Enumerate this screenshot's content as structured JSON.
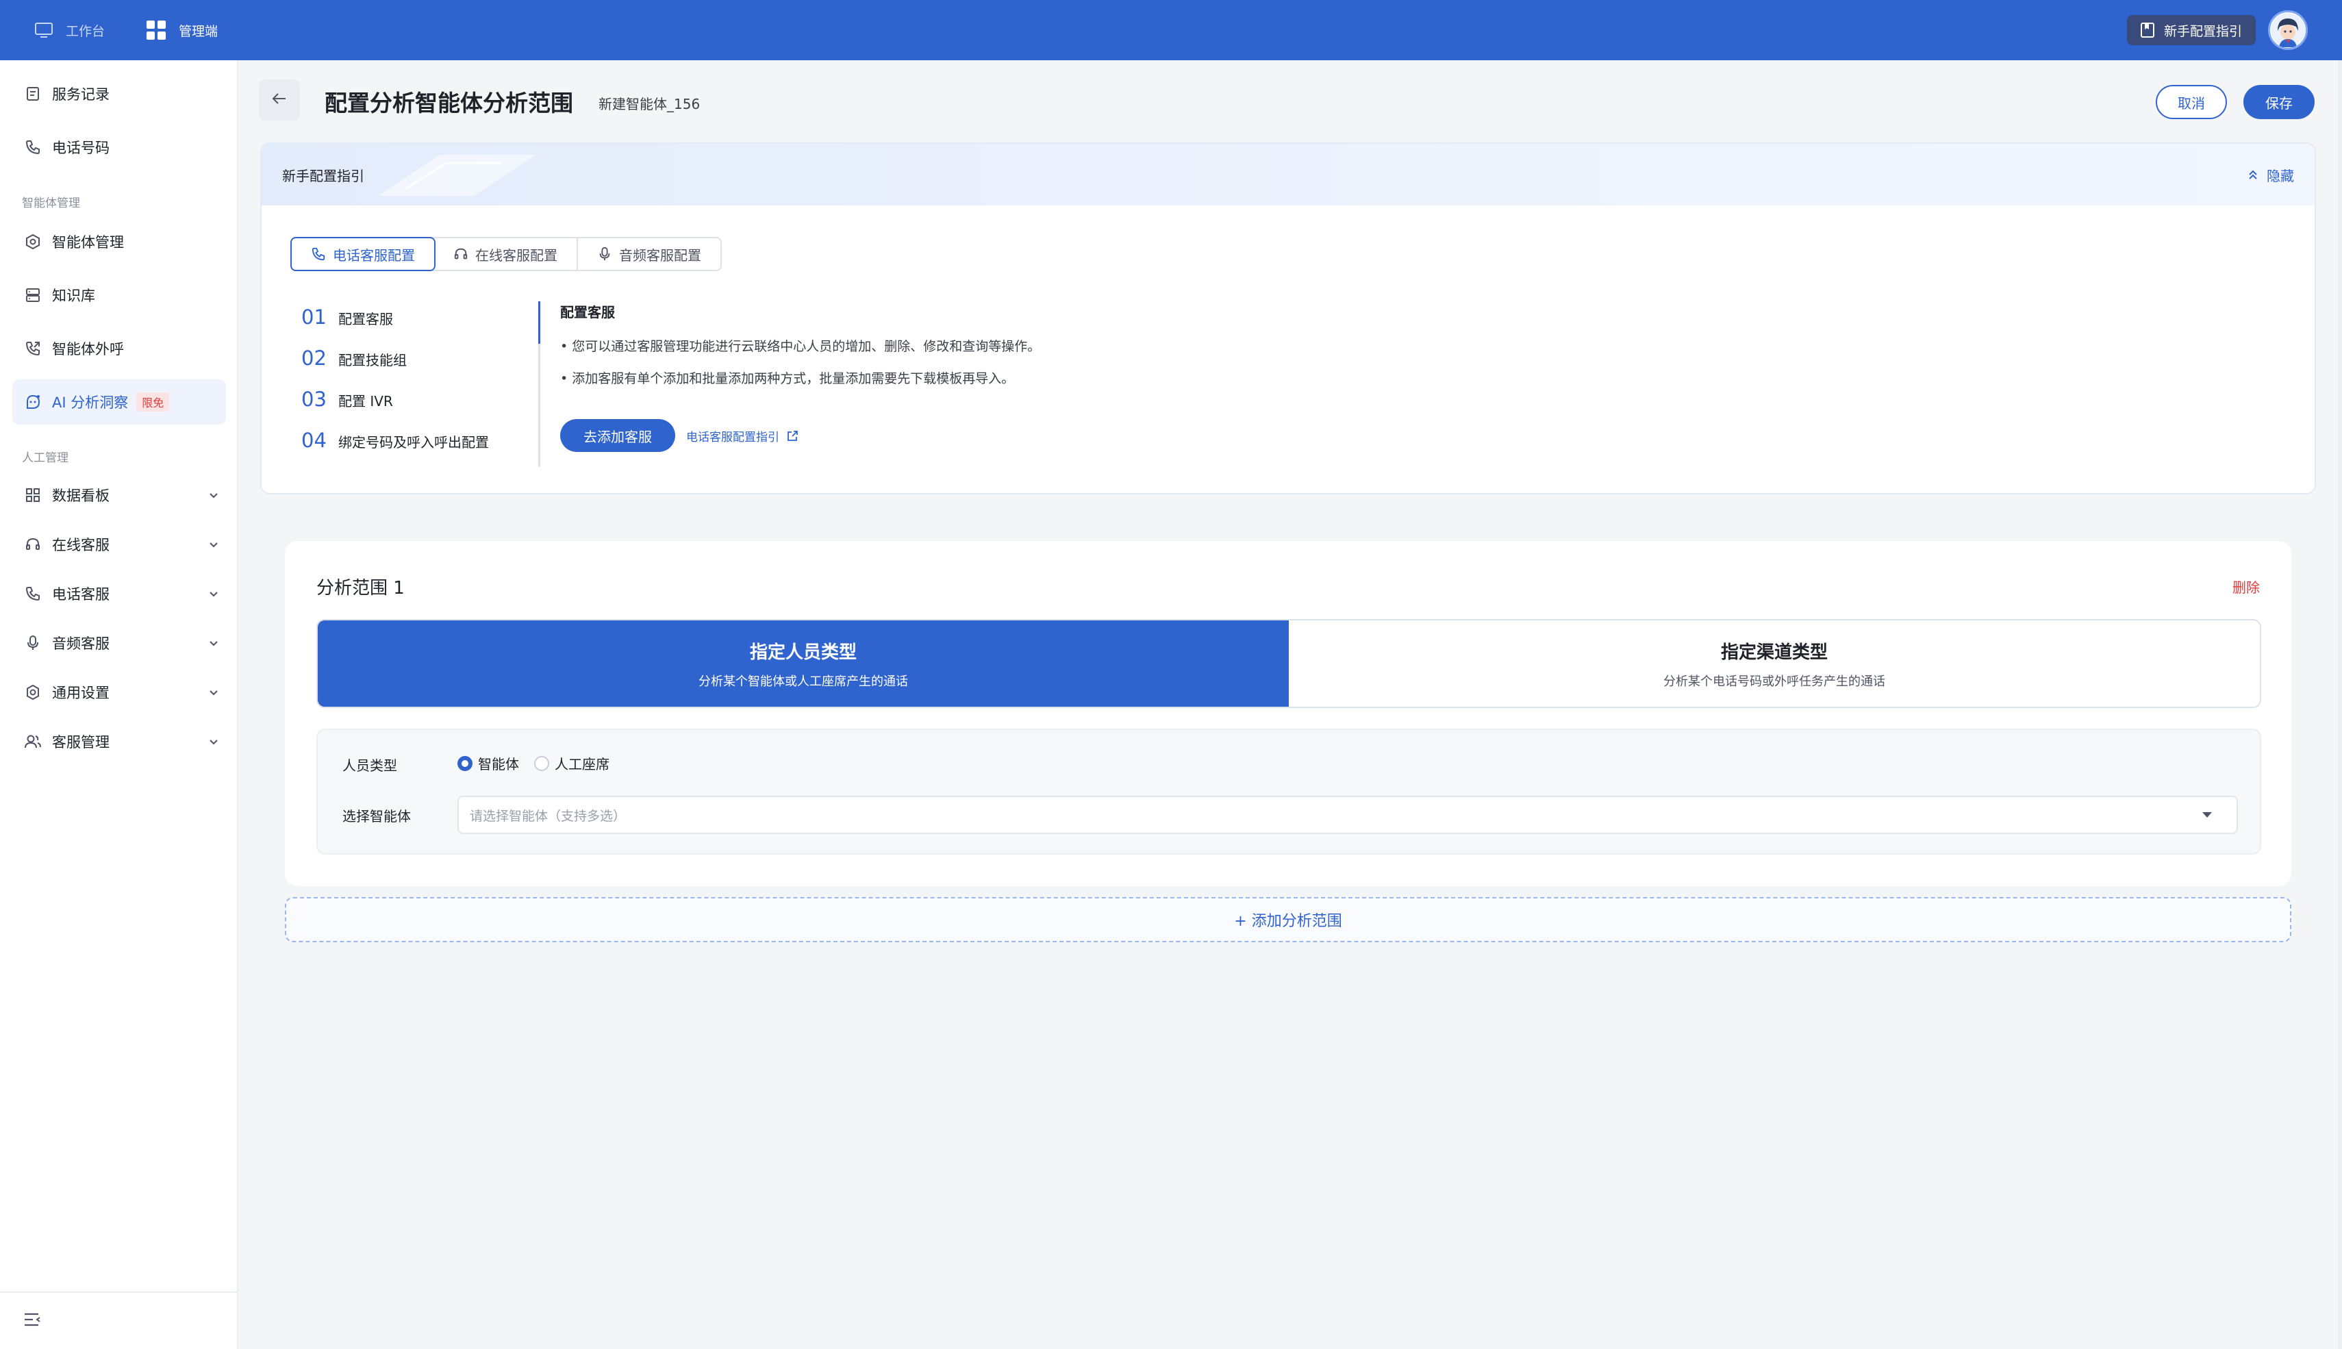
{
  "topbar": {
    "tabs": [
      {
        "label": "工作台",
        "icon": "monitor-icon"
      },
      {
        "label": "管理端",
        "icon": "grid-icon"
      }
    ],
    "guide_button": "新手配置指引"
  },
  "sidebar": {
    "items_top": [
      {
        "label": "服务记录",
        "icon": "document-icon"
      },
      {
        "label": "电话号码",
        "icon": "phone-icon"
      }
    ],
    "section_agent": "智能体管理",
    "items_agent": [
      {
        "label": "智能体管理",
        "icon": "hexagon-gear-icon"
      },
      {
        "label": "知识库",
        "icon": "database-icon"
      },
      {
        "label": "智能体外呼",
        "icon": "phone-outgoing-icon"
      },
      {
        "label": "AI 分析洞察",
        "icon": "ai-robot-icon",
        "badge": "限免"
      }
    ],
    "section_human": "人工管理",
    "items_human": [
      {
        "label": "数据看板",
        "icon": "dashboard-icon"
      },
      {
        "label": "在线客服",
        "icon": "headset-icon"
      },
      {
        "label": "电话客服",
        "icon": "phone-icon"
      },
      {
        "label": "音频客服",
        "icon": "microphone-icon"
      },
      {
        "label": "通用设置",
        "icon": "gear-icon"
      },
      {
        "label": "客服管理",
        "icon": "users-icon"
      }
    ]
  },
  "header": {
    "title": "配置分析智能体分析范围",
    "subtitle": "新建智能体_156",
    "cancel": "取消",
    "save": "保存"
  },
  "guide": {
    "title": "新手配置指引",
    "hide": "隐藏",
    "tabs": [
      "电话客服配置",
      "在线客服配置",
      "音频客服配置"
    ],
    "steps": [
      {
        "num": "01",
        "label": "配置客服"
      },
      {
        "num": "02",
        "label": "配置技能组"
      },
      {
        "num": "03",
        "label": "配置 IVR"
      },
      {
        "num": "04",
        "label": "绑定号码及呼入呼出配置"
      }
    ],
    "detail": {
      "title": "配置客服",
      "lines": [
        "• 您可以通过客服管理功能进行云联络中心人员的增加、删除、修改和查询等操作。",
        "• 添加客服有单个添加和批量添加两种方式，批量添加需要先下载模板再导入。"
      ],
      "button": "去添加客服",
      "link": "电话客服配置指引"
    }
  },
  "range": {
    "title": "分析范围 1",
    "delete": "删除",
    "types": [
      {
        "title": "指定人员类型",
        "desc": "分析某个智能体或人工座席产生的通话"
      },
      {
        "title": "指定渠道类型",
        "desc": "分析某个电话号码或外呼任务产生的通话"
      }
    ],
    "person_type_label": "人员类型",
    "person_options": [
      "智能体",
      "人工座席"
    ],
    "select_label": "选择智能体",
    "select_placeholder": "请选择智能体（支持多选）"
  },
  "add_range": "+ 添加分析范围",
  "colors": {
    "primary": "#2f63ce",
    "danger": "#e03b3b",
    "badge_bg": "#fde4e4"
  }
}
